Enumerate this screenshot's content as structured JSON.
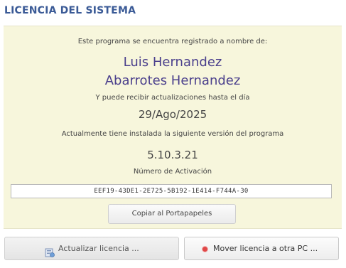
{
  "window": {
    "title": "LICENCIA DEL SISTEMA"
  },
  "license": {
    "registered_to_text": "Este programa se encuentra registrado a nombre de:",
    "owner_name": "Luis Hernandez",
    "company_name": "Abarrotes Hernandez",
    "updates_until_text": "Y puede recibir actualizaciones hasta el día",
    "updates_until_date": "29/Ago/2025",
    "installed_version_text": "Actualmente tiene instalada la siguiente versión del programa",
    "version": "5.10.3.21",
    "activation_label": "Número de Activación",
    "activation_number": "EEF19-43DE1-2E725-5B192-1E414-F744A-30"
  },
  "buttons": {
    "copy_label": "Copiar al Portapapeles",
    "update_label": "Actualizar licencia ...",
    "move_label": "Mover licencia a otra PC ..."
  },
  "icons": {
    "update": "license-update-icon",
    "move": "red-dot-icon"
  },
  "colors": {
    "title": "#3a5a96",
    "panel_background": "#f7f6dc",
    "owner_text": "#4a3f8c",
    "move_icon": "#e04848"
  }
}
